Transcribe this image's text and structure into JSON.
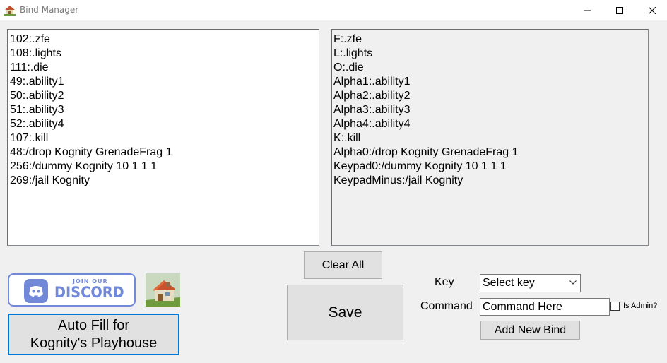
{
  "window": {
    "title": "Bind Manager",
    "icon": "house-icon",
    "controls": [
      "minimize-icon",
      "maximize-icon",
      "close-icon"
    ]
  },
  "left_list": {
    "items": [
      "102:.zfe",
      "108:.lights",
      "111:.die",
      "49:.ability1",
      "50:.ability2",
      "51:.ability3",
      "52:.ability4",
      "107:.kill",
      "48:/drop Kognity GrenadeFrag 1",
      "256:/dummy Kognity 10 1 1 1",
      "269:/jail Kognity"
    ]
  },
  "right_list": {
    "items": [
      "F:.zfe",
      "L:.lights",
      "O:.die",
      "Alpha1:.ability1",
      "Alpha2:.ability2",
      "Alpha3:.ability3",
      "Alpha4:.ability4",
      "K:.kill",
      "Alpha0:/drop Kognity GrenadeFrag 1",
      "Keypad0:/dummy Kognity 10 1 1 1",
      "KeypadMinus:/jail Kognity"
    ]
  },
  "discord": {
    "join_text": "JOIN OUR",
    "word": "DISCORD",
    "color": "#7289da",
    "icon": "discord-logo-icon"
  },
  "buttons": {
    "clear_all": "Clear All",
    "save": "Save",
    "add_new_bind": "Add New Bind",
    "autofill_line1": "Auto Fill for",
    "autofill_line2": "Kognity's Playhouse"
  },
  "form": {
    "key_label": "Key",
    "key_selected": "Select key",
    "command_label": "Command",
    "command_value": "Command Here",
    "is_admin_label": "Is Admin?",
    "is_admin_checked": false
  },
  "colors": {
    "accent": "#0078d7",
    "background": "#f0f0f0"
  }
}
